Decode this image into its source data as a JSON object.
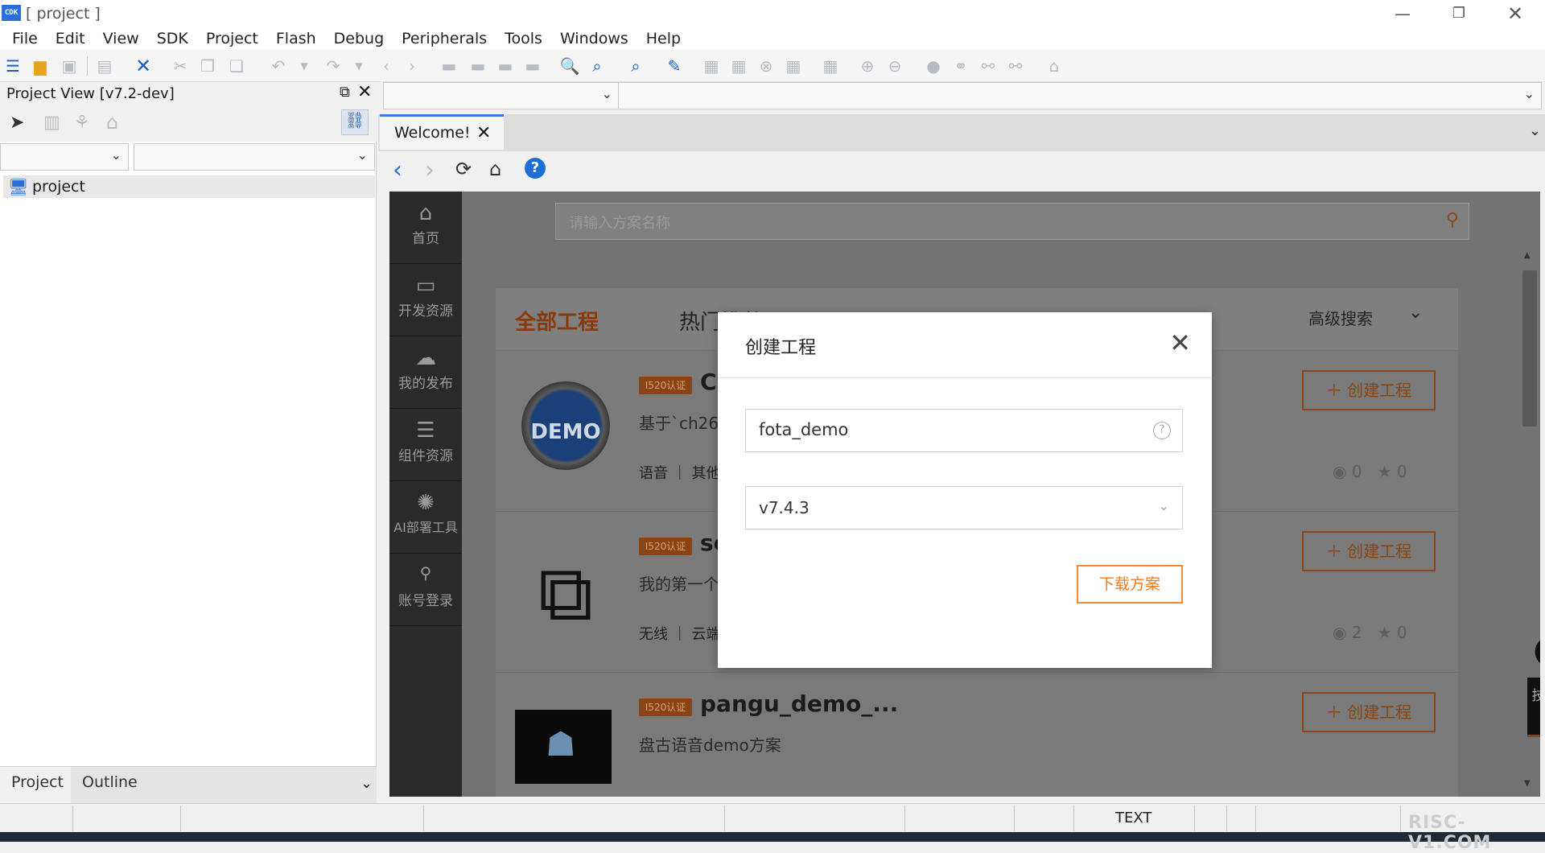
{
  "window": {
    "title": "[ project ]",
    "app_icon_text": "CDK"
  },
  "menu": [
    "File",
    "Edit",
    "View",
    "SDK",
    "Project",
    "Flash",
    "Debug",
    "Peripherals",
    "Tools",
    "Windows",
    "Help"
  ],
  "project_view": {
    "title": "Project View [v7.2-dev]",
    "tree_root": "project",
    "bottom_tabs": [
      "Project",
      "Outline"
    ]
  },
  "editor": {
    "tab_label": "Welcome!"
  },
  "web": {
    "sidebar": [
      {
        "label": "首页",
        "icon": "home-icon"
      },
      {
        "label": "开发资源",
        "icon": "code-icon"
      },
      {
        "label": "我的发布",
        "icon": "cloud-upload-icon"
      },
      {
        "label": "组件资源",
        "icon": "component-icon"
      },
      {
        "label": "AI部署工具",
        "icon": "ai-icon"
      },
      {
        "label": "账号登录",
        "icon": "user-icon"
      }
    ],
    "search_placeholder": "请输入方案名称",
    "tabs": {
      "all": "全部工程",
      "hot": "热门推荐",
      "advanced": "高级搜索"
    },
    "cards": [
      {
        "badge": "I520认证",
        "title": "Cl",
        "desc": "基于`ch26",
        "tags": "语音 ｜ 其他",
        "views": "0",
        "stars": "0",
        "button": "创建工程",
        "image": "DEMO"
      },
      {
        "badge": "I520认证",
        "title": "sc",
        "desc": "我的第一个",
        "tags": "无线 ｜ 云端",
        "views": "2",
        "stars": "0",
        "button": "创建工程",
        "image": "puzzle"
      },
      {
        "badge": "I520认证",
        "title": "pangu_demo_...",
        "desc": "盘古语音demo方案",
        "tags": "",
        "views": "",
        "stars": "",
        "button": "创建工程",
        "image": "pokemon"
      }
    ],
    "support_label": "技术支持"
  },
  "modal": {
    "title": "创建工程",
    "name_value": "fota_demo",
    "version_value": "v7.4.3",
    "download_label": "下载方案"
  },
  "status": {
    "text_mode": "TEXT"
  },
  "watermark": "RISC-V1.COM"
}
